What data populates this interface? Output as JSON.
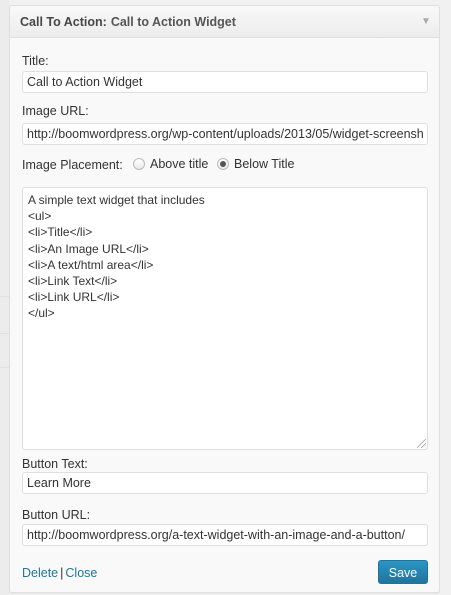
{
  "widget": {
    "title_prefix": "Call To Action:",
    "title_in": "Call to Action Widget"
  },
  "form": {
    "title_label": "Title:",
    "title_value": "Call to Action Widget",
    "image_url_label": "Image URL:",
    "image_url_value": "http://boomwordpress.org/wp-content/uploads/2013/05/widget-screensho",
    "image_placement_label": "Image Placement:",
    "placement_options": [
      {
        "label": "Above title",
        "checked": false
      },
      {
        "label": "Below Title",
        "checked": true
      }
    ],
    "body_lines": [
      "A simple text widget that includes",
      "<ul>",
      "<li>Title</li>",
      "<li>An Image URL</li>",
      "<li>A text/html area</li>",
      "<li>Link Text</li>",
      "<li>Link URL</li>",
      "</ul>"
    ],
    "button_text_label": "Button Text:",
    "button_text_value": "Learn More",
    "button_url_label": "Button URL:",
    "button_url_value": "http://boomwordpress.org/a-text-widget-with-an-image-and-a-button/"
  },
  "controls": {
    "delete_label": "Delete",
    "separator": "|",
    "close_label": "Close",
    "save_label": "Save"
  },
  "icons": {
    "toggle": "triangle-down-icon"
  },
  "colors": {
    "link": "#21759b",
    "primary_button": "#21759b"
  }
}
